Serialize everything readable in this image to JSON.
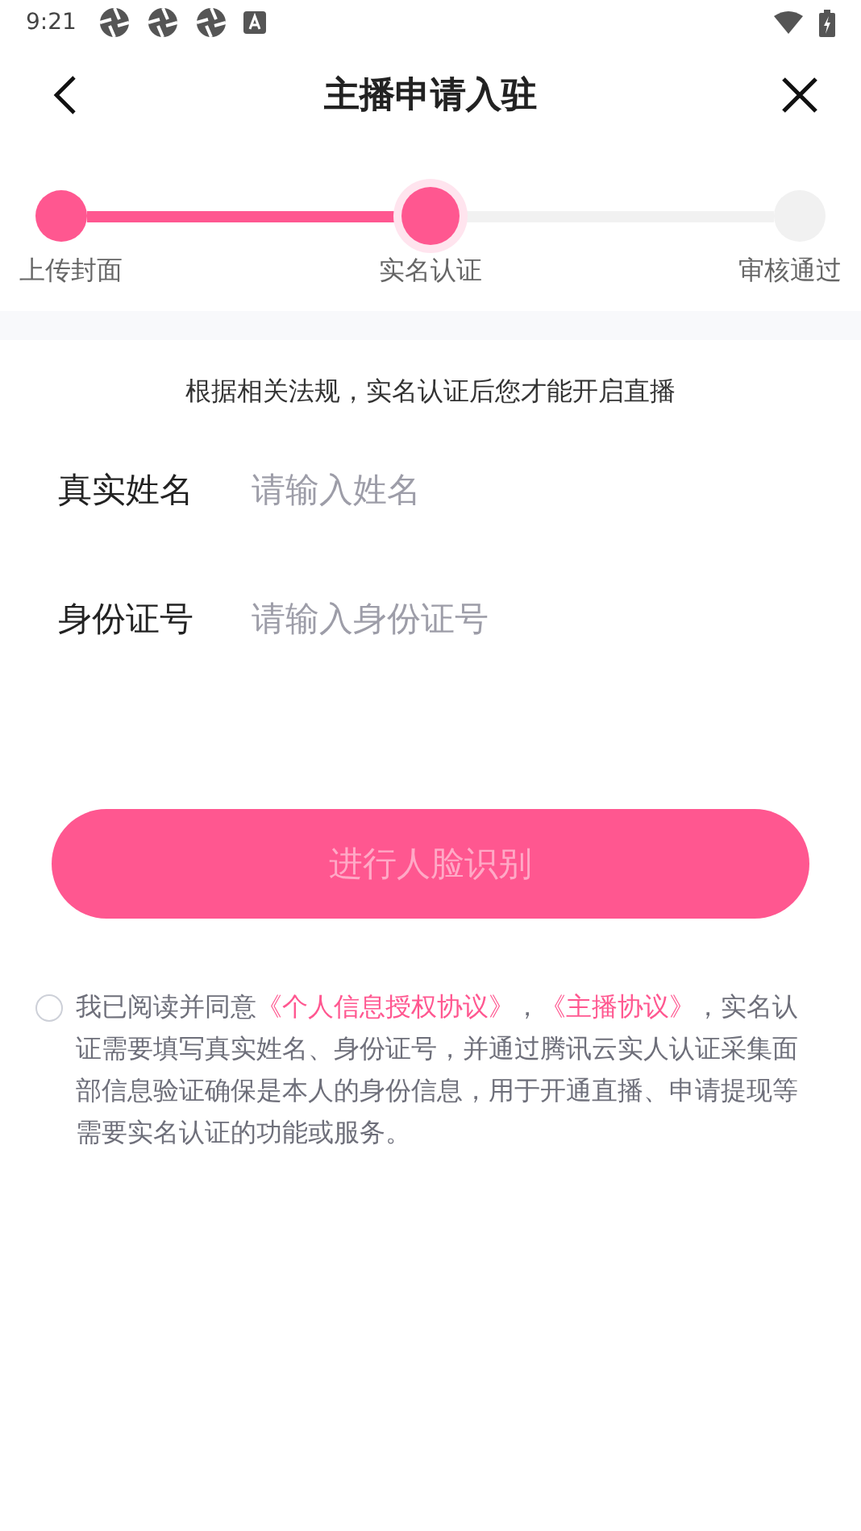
{
  "status_bar": {
    "time": "9:21"
  },
  "header": {
    "title": "主播申请入驻"
  },
  "steps": [
    {
      "label": "上传封面",
      "done": true,
      "selected": false
    },
    {
      "label": "实名认证",
      "done": true,
      "selected": true
    },
    {
      "label": "审核通过",
      "done": false,
      "selected": false
    }
  ],
  "notice": "根据相关法规，实名认证后您才能开启直播",
  "fields": [
    {
      "label": "真实姓名",
      "placeholder": "请输入姓名"
    },
    {
      "label": "身份证号",
      "placeholder": "请输入身份证号"
    }
  ],
  "submit": {
    "label": "进行人脸识别",
    "disabled": true
  },
  "agreement": {
    "checked": false,
    "parts": [
      {
        "kind": "text",
        "text": "我已阅读并同意"
      },
      {
        "kind": "link",
        "text": "《个人信息授权协议》"
      },
      {
        "kind": "text",
        "text": "，"
      },
      {
        "kind": "link",
        "text": "《主播协议》"
      },
      {
        "kind": "text",
        "text": "，实名认证需要填写真实姓名、身份证号，并通过腾讯云实人认证采集面部信息验证确保是本人的身份信息，用于开通直播、申请提现等需要实名认证的功能或服务。"
      }
    ]
  }
}
